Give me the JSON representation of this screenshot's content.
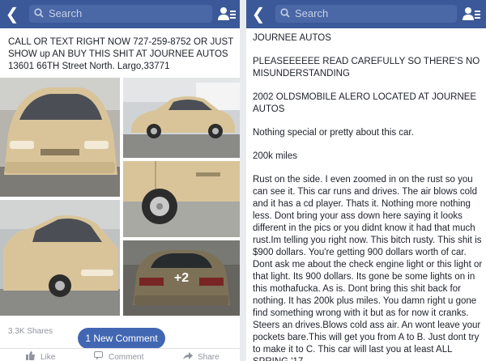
{
  "search": {
    "placeholder": "Search"
  },
  "left_post": {
    "text": "CALL OR TEXT RIGHT NOW 727-259-8752 OR JUST SHOW up AN BUY THIS SHIT AT JOURNEE AUTOS 13601 66TH Street North. Largo,33771",
    "more_photos": "+2",
    "shares": "3.3K Shares",
    "new_comment": "1 New Comment",
    "actions": {
      "like": "Like",
      "comment": "Comment",
      "share": "Share"
    }
  },
  "right_post": {
    "paragraphs": [
      "JOURNEE AUTOS",
      "PLEASEEEEEE READ CAREFULLY SO THERE'S NO MISUNDERSTANDING",
      "2002 OLDSMOBILE ALERO LOCATED AT JOURNEE AUTOS",
      "Nothing special or pretty about this car.",
      "200k miles",
      "Rust on the side. I even zoomed in on the rust so you can see it. This car runs and drives. The air blows cold and it has a cd player. Thats it. Nothing more nothing less. Dont bring your ass down here saying it looks different in the pics or you didnt know it had that much rust.Im telling you right now. This bitch rusty. This shit is $900 dollars. You're getting 900 dollars worth of car. Dont ask me about the check engine light or this light or that light. Its 900 dollars. Its gone be some lights on in this mothafucka. As is. Dont bring this shit back for nothing. It has 200k plus miles. You damn right u gone find something wrong with it but as for now it cranks. Steers an drives.Blows cold ass air. An wont leave your pockets bare.This will get you from A to B. Just dont try to make it to C. This car will last you at least ALL SPRING '17"
    ]
  },
  "colors": {
    "navbar": "#3b5998",
    "search_box": "#4a67a6",
    "button": "#4267b2",
    "car_paint": "#d9c49a"
  },
  "icons": [
    "back-arrow-icon",
    "search-icon",
    "friends-icon",
    "like-icon",
    "comment-icon",
    "share-icon"
  ]
}
